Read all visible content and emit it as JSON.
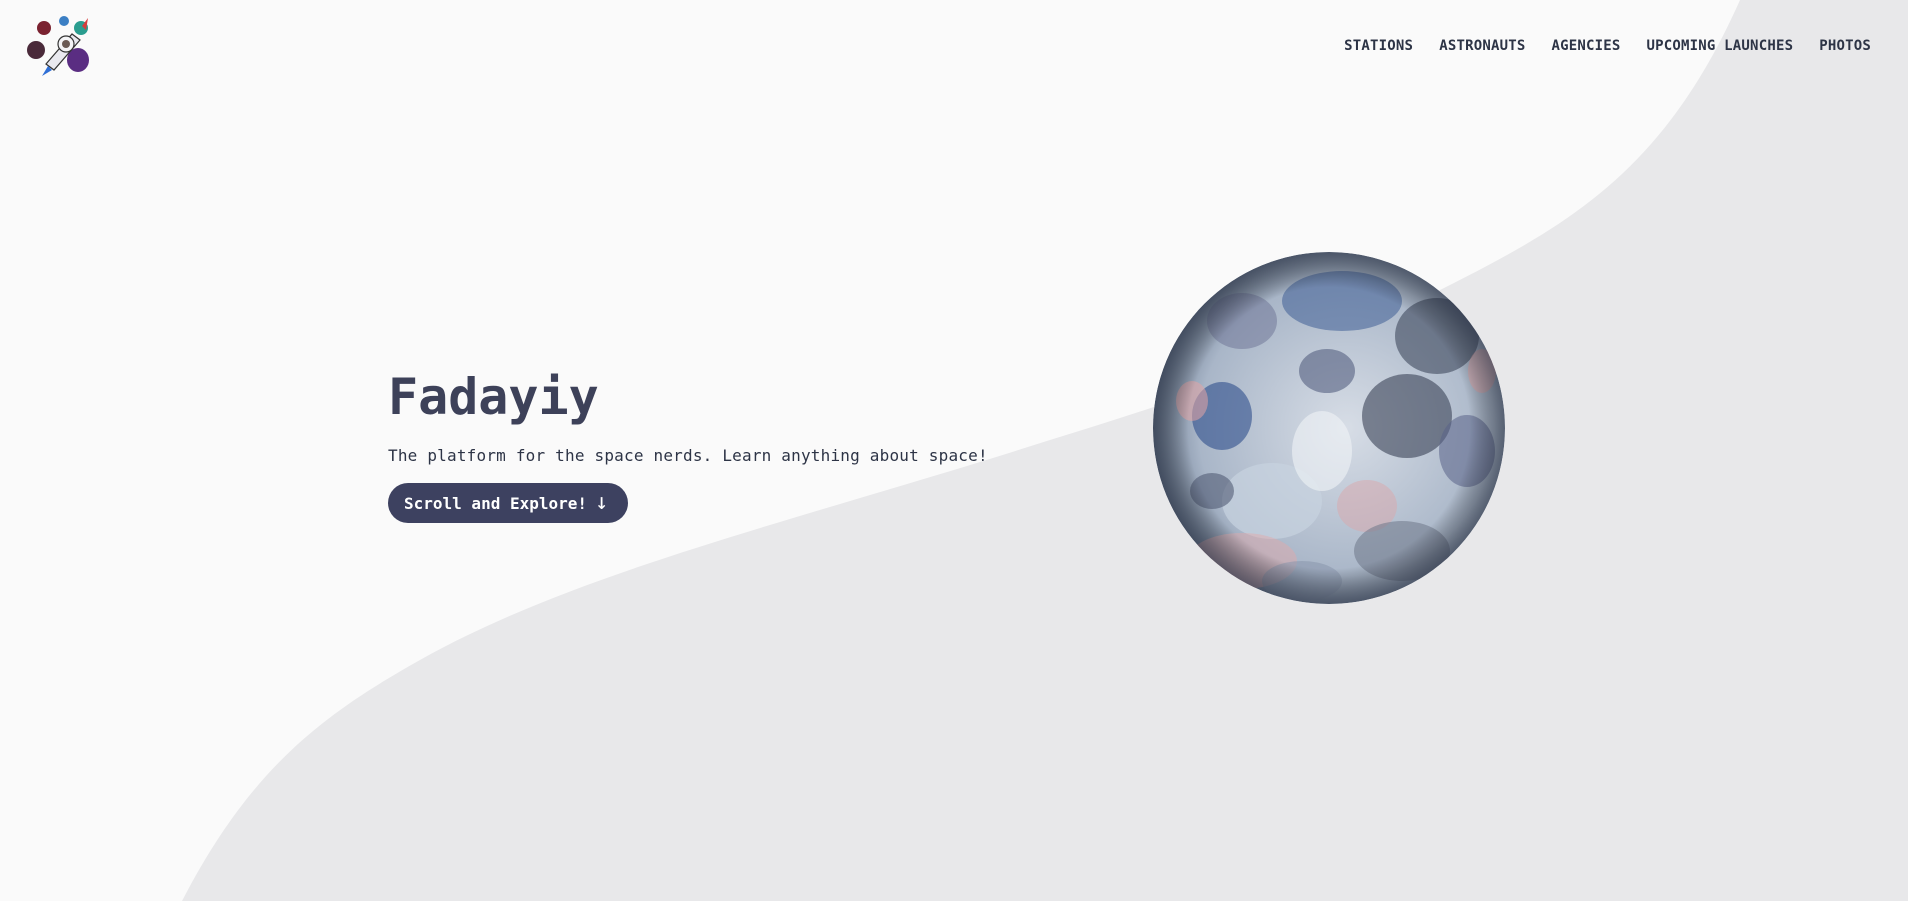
{
  "nav": {
    "items": [
      {
        "label": "STATIONS"
      },
      {
        "label": "ASTRONAUTS"
      },
      {
        "label": "AGENCIES"
      },
      {
        "label": "UPCOMING LAUNCHES"
      },
      {
        "label": "PHOTOS"
      }
    ]
  },
  "hero": {
    "title": "Fadayiy",
    "tagline": "The platform for the space nerds. Learn anything about space!",
    "cta_label": "Scroll and Explore!",
    "cta_icon": "arrow-down-icon"
  },
  "colors": {
    "background": "#fafafa",
    "wave": "#e8e8ea",
    "text_dark": "#2d3446",
    "title": "#3d4159",
    "button": "#3d4160"
  }
}
